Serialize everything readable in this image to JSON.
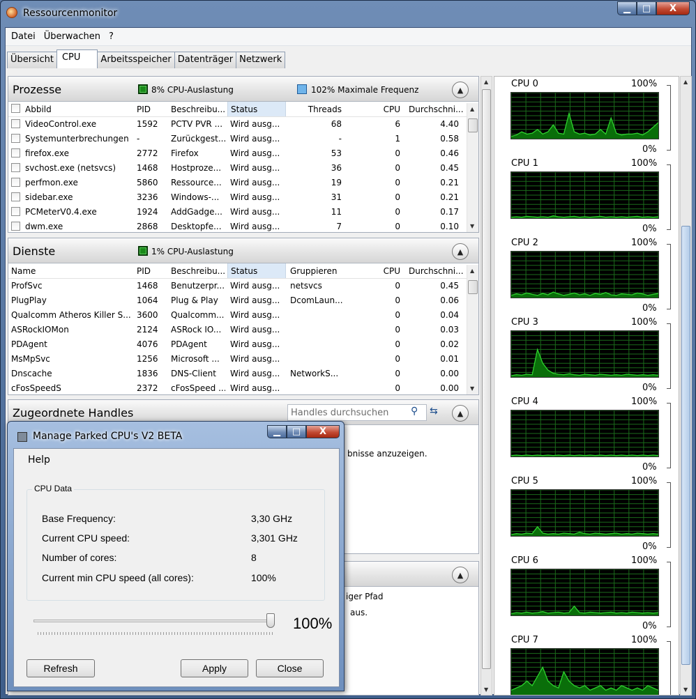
{
  "window": {
    "title": "Ressourcenmonitor",
    "minimize": "▁",
    "maximize": "□",
    "close": "X"
  },
  "menu": [
    "Datei",
    "Überwachen",
    "?"
  ],
  "tabs": [
    "Übersicht",
    "CPU",
    "Arbeitsspeicher",
    "Datenträger",
    "Netzwerk"
  ],
  "processes": {
    "title": "Prozesse",
    "cpu_usage": "8% CPU-Auslastung",
    "max_freq": "102% Maximale Frequenz",
    "columns": [
      "Abbild",
      "PID",
      "Beschreibu...",
      "Status",
      "Threads",
      "CPU",
      "Durchschni..."
    ],
    "rows": [
      [
        "VideoControl.exe",
        "1592",
        "PCTV PVR ...",
        "Wird ausg...",
        "68",
        "6",
        "4.40"
      ],
      [
        "Systemunterbrechungen",
        "-",
        "Zurückgest...",
        "Wird ausg...",
        "-",
        "1",
        "0.58"
      ],
      [
        "firefox.exe",
        "2772",
        "Firefox",
        "Wird ausg...",
        "53",
        "0",
        "0.46"
      ],
      [
        "svchost.exe (netsvcs)",
        "1468",
        "Hostproze...",
        "Wird ausg...",
        "36",
        "0",
        "0.45"
      ],
      [
        "perfmon.exe",
        "5860",
        "Ressource...",
        "Wird ausg...",
        "19",
        "0",
        "0.21"
      ],
      [
        "sidebar.exe",
        "3236",
        "Windows-...",
        "Wird ausg...",
        "31",
        "0",
        "0.21"
      ],
      [
        "PCMeterV0.4.exe",
        "1924",
        "AddGadge...",
        "Wird ausg...",
        "11",
        "0",
        "0.17"
      ],
      [
        "dwm.exe",
        "2868",
        "Desktopfe...",
        "Wird ausg...",
        "7",
        "0",
        "0.10"
      ]
    ]
  },
  "services": {
    "title": "Dienste",
    "cpu_usage": "1% CPU-Auslastung",
    "columns": [
      "Name",
      "PID",
      "Beschreibu...",
      "Status",
      "Gruppieren",
      "CPU",
      "Durchschni..."
    ],
    "rows": [
      [
        "ProfSvc",
        "1468",
        "Benutzerpr...",
        "Wird ausg...",
        "netsvcs",
        "0",
        "0.45"
      ],
      [
        "PlugPlay",
        "1064",
        "Plug & Play",
        "Wird ausg...",
        "DcomLaun...",
        "0",
        "0.06"
      ],
      [
        "Qualcomm Atheros Killer S...",
        "3600",
        "Qualcomm...",
        "Wird ausg...",
        "",
        "0",
        "0.04"
      ],
      [
        "ASRockIOMon",
        "2124",
        "ASRock IO...",
        "Wird ausg...",
        "",
        "0",
        "0.03"
      ],
      [
        "PDAgent",
        "4076",
        "PDAgent",
        "Wird ausg...",
        "",
        "0",
        "0.02"
      ],
      [
        "MsMpSvc",
        "1256",
        "Microsoft ...",
        "Wird ausg...",
        "",
        "0",
        "0.01"
      ],
      [
        "Dnscache",
        "1836",
        "DNS-Client",
        "Wird ausg...",
        "NetworkS...",
        "0",
        "0.00"
      ],
      [
        "cFosSpeedS",
        "2372",
        "cFosSpeed ...",
        "Wird ausg...",
        "",
        "0",
        "0.00"
      ]
    ]
  },
  "handles": {
    "title": "Zugeordnete Handles",
    "search_placeholder": "Handles durchsuchen",
    "hint_fragment": "bnisse anzuzeigen."
  },
  "modules": {
    "path_fragment": "iger Pfad",
    "aus_fragment": "aus."
  },
  "cpus": [
    {
      "name": "CPU 0",
      "max": "100%",
      "min": "0%",
      "trace": [
        0.05,
        0.08,
        0.15,
        0.1,
        0.12,
        0.2,
        0.1,
        0.15,
        0.3,
        0.12,
        0.1,
        0.55,
        0.15,
        0.1,
        0.12,
        0.08,
        0.1,
        0.2,
        0.1,
        0.45,
        0.12,
        0.08,
        0.1,
        0.1,
        0.12,
        0.08,
        0.15,
        0.25,
        0.35
      ]
    },
    {
      "name": "CPU 1",
      "max": "100%",
      "min": "0%",
      "trace": [
        0.02,
        0.03,
        0.02,
        0.04,
        0.03,
        0.02,
        0.03,
        0.02,
        0.05,
        0.03,
        0.02,
        0.03,
        0.04,
        0.02,
        0.03,
        0.02,
        0.03,
        0.04,
        0.02,
        0.03,
        0.02,
        0.03,
        0.02,
        0.03,
        0.04,
        0.02,
        0.03,
        0.02,
        0.03
      ]
    },
    {
      "name": "CPU 2",
      "max": "100%",
      "min": "0%",
      "trace": [
        0.05,
        0.08,
        0.06,
        0.1,
        0.07,
        0.05,
        0.09,
        0.06,
        0.12,
        0.08,
        0.05,
        0.07,
        0.1,
        0.06,
        0.08,
        0.05,
        0.09,
        0.07,
        0.11,
        0.06,
        0.05,
        0.08,
        0.07,
        0.06,
        0.1,
        0.08,
        0.05,
        0.07,
        0.09
      ]
    },
    {
      "name": "CPU 3",
      "max": "100%",
      "min": "0%",
      "trace": [
        0.03,
        0.05,
        0.04,
        0.06,
        0.05,
        0.6,
        0.3,
        0.15,
        0.08,
        0.06,
        0.05,
        0.07,
        0.05,
        0.04,
        0.06,
        0.05,
        0.04,
        0.06,
        0.05,
        0.04,
        0.05,
        0.04,
        0.06,
        0.05,
        0.04,
        0.05,
        0.04,
        0.05,
        0.04
      ]
    },
    {
      "name": "CPU 4",
      "max": "100%",
      "min": "0%",
      "trace": [
        0.02,
        0.03,
        0.02,
        0.03,
        0.02,
        0.03,
        0.02,
        0.03,
        0.02,
        0.03,
        0.02,
        0.03,
        0.02,
        0.03,
        0.02,
        0.03,
        0.02,
        0.03,
        0.02,
        0.03,
        0.02,
        0.03,
        0.02,
        0.03,
        0.02,
        0.03,
        0.02,
        0.03,
        0.02
      ]
    },
    {
      "name": "CPU 5",
      "max": "100%",
      "min": "0%",
      "trace": [
        0.03,
        0.05,
        0.04,
        0.06,
        0.05,
        0.2,
        0.06,
        0.04,
        0.05,
        0.04,
        0.06,
        0.05,
        0.04,
        0.08,
        0.05,
        0.04,
        0.06,
        0.05,
        0.04,
        0.05,
        0.06,
        0.04,
        0.05,
        0.04,
        0.06,
        0.05,
        0.04,
        0.05,
        0.04
      ]
    },
    {
      "name": "CPU 6",
      "max": "100%",
      "min": "0%",
      "trace": [
        0.04,
        0.06,
        0.05,
        0.07,
        0.05,
        0.06,
        0.08,
        0.05,
        0.06,
        0.07,
        0.05,
        0.06,
        0.2,
        0.06,
        0.05,
        0.07,
        0.06,
        0.05,
        0.06,
        0.07,
        0.05,
        0.06,
        0.05,
        0.07,
        0.06,
        0.05,
        0.06,
        0.05,
        0.06
      ]
    },
    {
      "name": "CPU 7",
      "max": "100%",
      "min": "",
      "trace": [
        0.1,
        0.15,
        0.2,
        0.3,
        0.2,
        0.4,
        0.6,
        0.3,
        0.2,
        0.15,
        0.5,
        0.3,
        0.2,
        0.15,
        0.2,
        0.1,
        0.15,
        0.2,
        0.1,
        0.15,
        0.1,
        0.2,
        0.15,
        0.1,
        0.15,
        0.1,
        0.2,
        0.15,
        0.1
      ]
    }
  ],
  "dialog": {
    "title": "Manage Parked CPU's V2 BETA",
    "menu_help": "Help",
    "group_title": "CPU Data",
    "fields": [
      {
        "label": "Base Frequency:",
        "value": "3,30 GHz"
      },
      {
        "label": "Current CPU speed:",
        "value": "3,301 GHz"
      },
      {
        "label": "Number of cores:",
        "value": "8"
      },
      {
        "label": "Current min CPU speed (all cores):",
        "value": "100%"
      }
    ],
    "slider_percent": 100,
    "slider_label": "100%",
    "refresh": "Refresh",
    "apply": "Apply",
    "close": "Close"
  },
  "colors": {
    "graph_line": "#2ed12e",
    "graph_fill": "#0a6e0a",
    "graph_grid": "#1b6b1b"
  }
}
